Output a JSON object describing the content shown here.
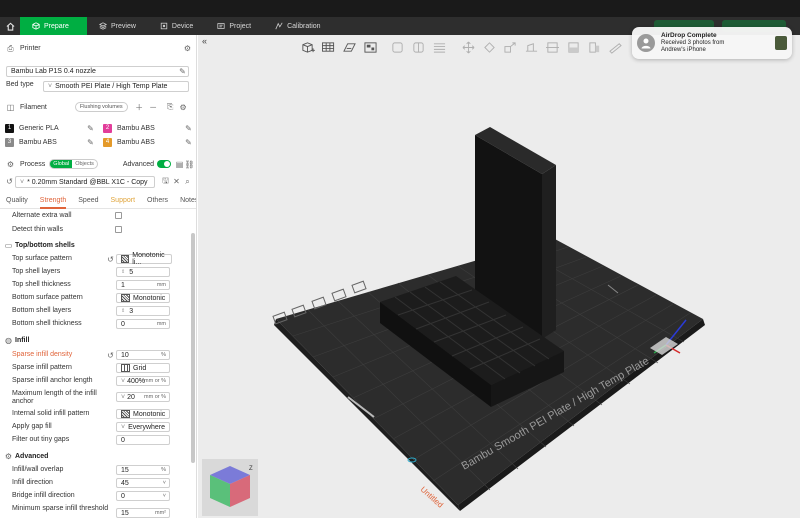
{
  "topbar": {
    "tabs": [
      {
        "label": "Prepare",
        "active": true
      },
      {
        "label": "Preview",
        "active": false
      },
      {
        "label": "Device",
        "active": false
      },
      {
        "label": "Project",
        "active": false
      },
      {
        "label": "Calibration",
        "active": false
      }
    ]
  },
  "printer": {
    "section_title": "Printer",
    "name": "Bambu Lab P1S 0.4 nozzle",
    "bed_type_label": "Bed type",
    "bed_type_value": "Smooth PEI Plate / High Temp Plate"
  },
  "filament": {
    "section_title": "Filament",
    "flushing_label": "Flushing volumes",
    "items": [
      {
        "num": "1",
        "name": "Generic PLA",
        "color": "#111111"
      },
      {
        "num": "2",
        "name": "Bambu ABS",
        "color": "#e23d9a"
      },
      {
        "num": "3",
        "name": "Bambu ABS",
        "color": "#8a8a8a"
      },
      {
        "num": "4",
        "name": "Bambu ABS",
        "color": "#e49a2a"
      }
    ]
  },
  "process": {
    "section_title": "Process",
    "seg_global": "Global",
    "seg_objects": "Objects",
    "advanced_label": "Advanced",
    "advanced_on": true,
    "preset": "* 0.20mm Standard @BBL X1C - Copy",
    "subtabs": [
      "Quality",
      "Strength",
      "Speed",
      "Support",
      "Others",
      "Notes"
    ]
  },
  "settings": {
    "alternate_extra_wall": "Alternate extra wall",
    "detect_thin_walls": "Detect thin walls",
    "top_bottom_title": "Top/bottom shells",
    "top_surface_pattern_label": "Top surface pattern",
    "top_surface_pattern_value": "Monotonic li...",
    "top_shell_layers_label": "Top shell layers",
    "top_shell_layers_value": "5",
    "top_shell_thickness_label": "Top shell thickness",
    "top_shell_thickness_value": "1",
    "top_shell_thickness_unit": "mm",
    "bottom_surface_pattern_label": "Bottom surface pattern",
    "bottom_surface_pattern_value": "Monotonic",
    "bottom_shell_layers_label": "Bottom shell layers",
    "bottom_shell_layers_value": "3",
    "bottom_shell_thickness_label": "Bottom shell thickness",
    "bottom_shell_thickness_value": "0",
    "bottom_shell_thickness_unit": "mm",
    "infill_title": "Infill",
    "sparse_density_label": "Sparse infill density",
    "sparse_density_value": "10",
    "sparse_density_unit": "%",
    "sparse_pattern_label": "Sparse infill pattern",
    "sparse_pattern_value": "Grid",
    "anchor_length_label": "Sparse infill anchor length",
    "anchor_length_value": "400%",
    "anchor_length_unit": "mm or %",
    "max_anchor_label": "Maximum length of the infill anchor",
    "max_anchor_value": "20",
    "max_anchor_unit": "mm or %",
    "internal_solid_label": "Internal solid infill pattern",
    "internal_solid_value": "Monotonic",
    "apply_gap_fill_label": "Apply gap fill",
    "apply_gap_fill_value": "Everywhere",
    "filter_gaps_label": "Filter out tiny gaps",
    "filter_gaps_value": "0",
    "advanced_title": "Advanced",
    "infill_wall_overlap_label": "Infill/wall overlap",
    "infill_wall_overlap_value": "15",
    "infill_wall_overlap_unit": "%",
    "infill_direction_label": "Infill direction",
    "infill_direction_value": "45",
    "bridge_direction_label": "Bridge infill direction",
    "bridge_direction_value": "0",
    "min_sparse_label": "Minimum sparse infill threshold",
    "min_sparse_value": "15",
    "min_sparse_unit": "mm²"
  },
  "viewport": {
    "plate_label": "Bambu Smooth PEI Plate / High Temp Plate",
    "plate_name": "Untitled",
    "axis_z": "Z"
  },
  "notification": {
    "title": "AirDrop Complete",
    "line1": "Received 3 photos from",
    "line2": "Andrew's iPhone"
  }
}
